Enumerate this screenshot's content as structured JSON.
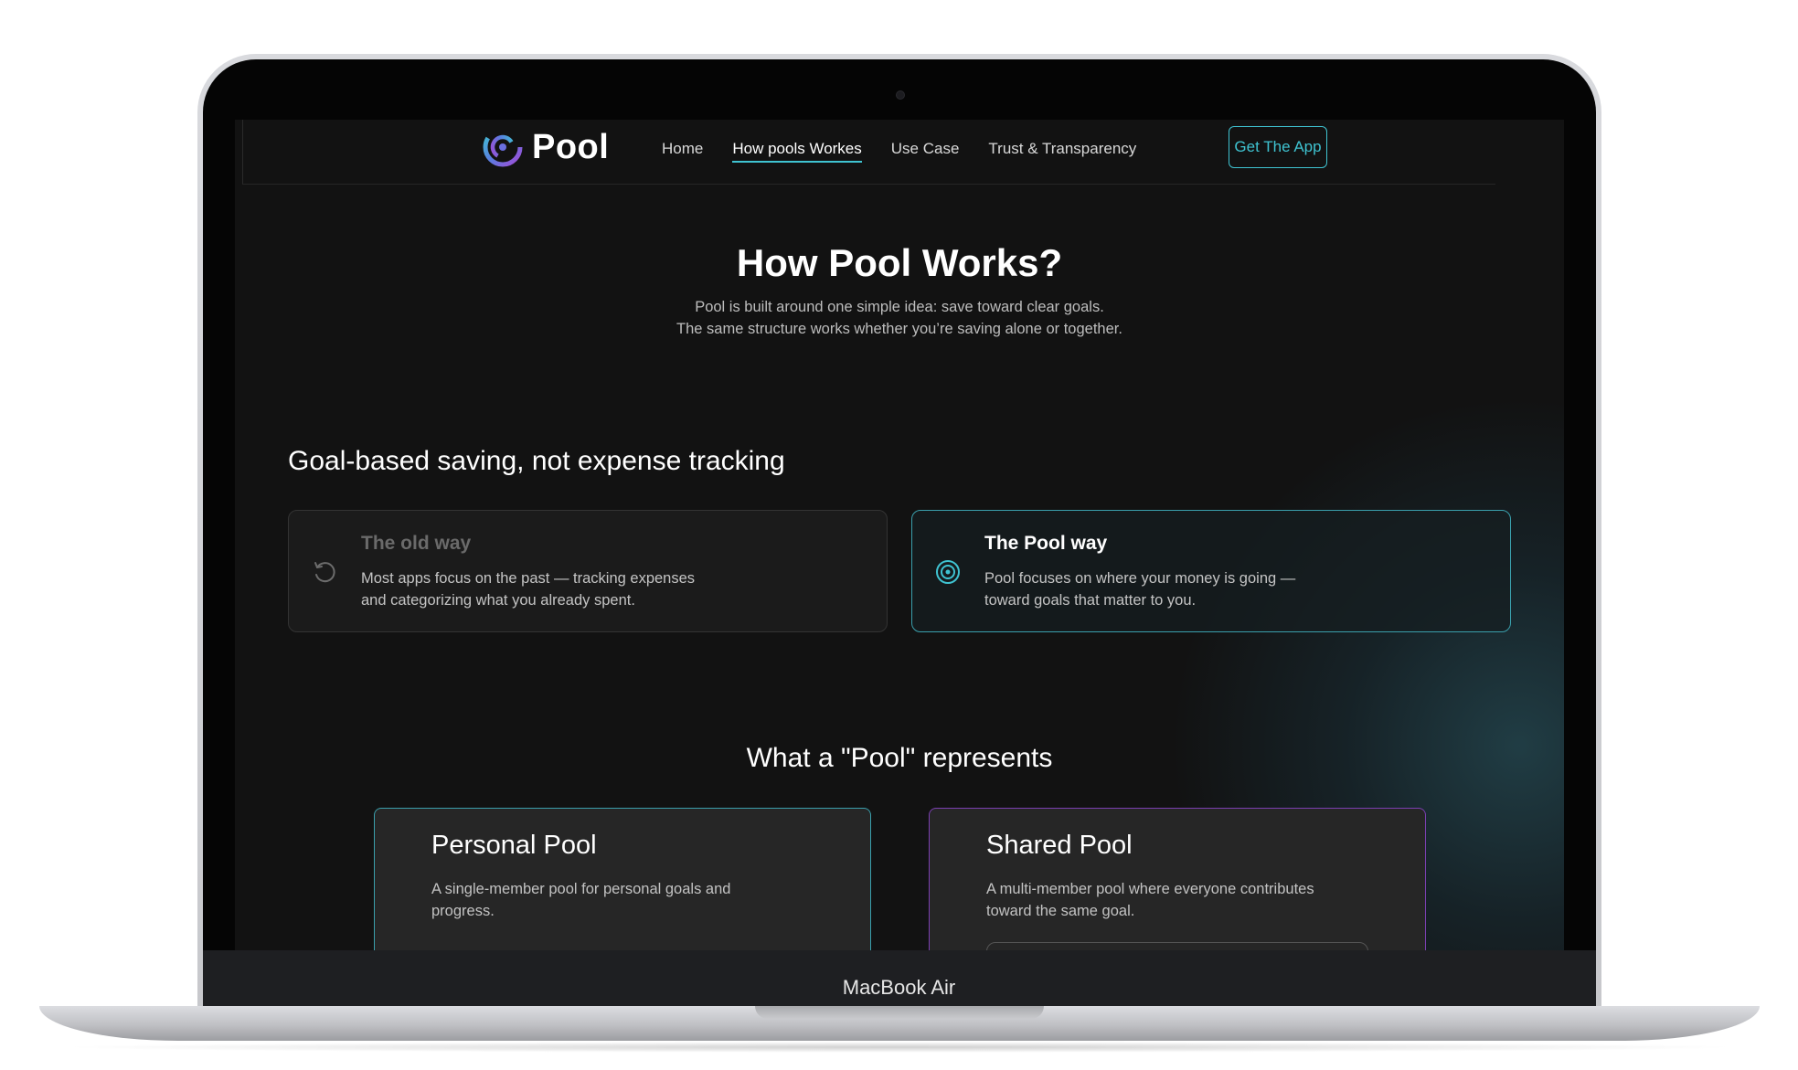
{
  "device": {
    "model_label": "MacBook Air"
  },
  "nav": {
    "brand": "Pool",
    "links": [
      {
        "label": "Home",
        "active": false
      },
      {
        "label": "How pools Workes",
        "active": true
      },
      {
        "label": "Use Case",
        "active": false
      },
      {
        "label": "Trust & Transparency",
        "active": false
      }
    ],
    "cta_label": "Get The App"
  },
  "hero": {
    "title": "How Pool Works?",
    "subtitle_line1": "Pool is built around one simple idea: save toward clear goals.",
    "subtitle_line2": "The same structure works whether you’re saving alone or together."
  },
  "comparison": {
    "heading": "Goal-based saving, not expense tracking",
    "old_way": {
      "title": "The old way",
      "text_line1": "Most apps focus on the past — tracking expenses",
      "text_line2": "and categorizing what you already spent.",
      "icon": "history-icon"
    },
    "pool_way": {
      "title": "The Pool way",
      "text_line1": "Pool focuses on where your money is going —",
      "text_line2": "toward goals that matter to you.",
      "icon": "target-icon"
    }
  },
  "represents": {
    "heading": "What a \"Pool\" represents",
    "personal": {
      "title": "Personal Pool",
      "text_line1": "A single-member pool for personal goals and",
      "text_line2": "progress."
    },
    "shared": {
      "title": "Shared Pool",
      "text_line1": "A multi-member pool where everyone contributes",
      "text_line2": "toward the same goal."
    }
  },
  "colors": {
    "accent_teal": "#3fc3d1",
    "accent_purple": "#7b3fb1",
    "background": "#121212"
  }
}
